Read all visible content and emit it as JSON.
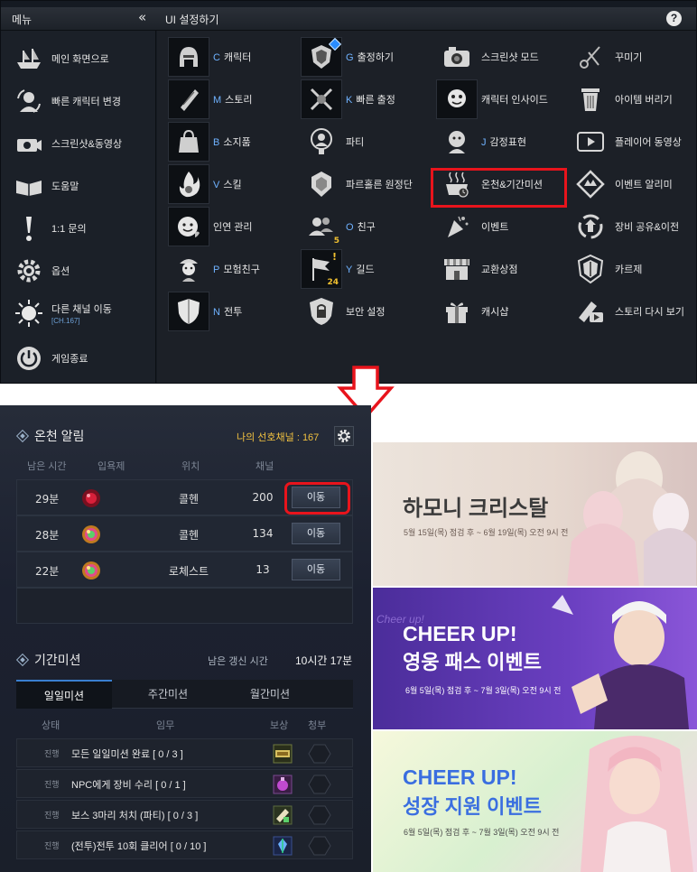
{
  "menu_window": {
    "left_title": "메뉴",
    "right_title": "UI 설정하기",
    "collapse_icon": "double-chevron-left-icon",
    "help_label": "?",
    "left_items": [
      {
        "label": "메인 화면으로",
        "icon": "ship-icon"
      },
      {
        "label": "빠른 캐릭터 변경",
        "icon": "character-swap-icon"
      },
      {
        "label": "스크린샷&동영상",
        "icon": "camera-icon"
      },
      {
        "label": "도움말",
        "icon": "book-icon"
      },
      {
        "label": "1:1 문의",
        "icon": "exclamation-icon"
      },
      {
        "label": "옵션",
        "icon": "gear-icon"
      },
      {
        "label": "다른 채널 이동",
        "sub": "[CH.167]",
        "icon": "sun-icon"
      },
      {
        "label": "게임종료",
        "icon": "power-icon"
      }
    ],
    "grid": [
      [
        {
          "hotkey": "C",
          "label": "캐릭터",
          "icon": "helmet-icon"
        },
        {
          "hotkey": "G",
          "label": "출정하기",
          "icon": "shield-crest-icon"
        },
        {
          "hotkey": "",
          "label": "스크린샷 모드",
          "icon": "camera-icon"
        },
        {
          "hotkey": "",
          "label": "꾸미기",
          "icon": "scissors-icon"
        }
      ],
      [
        {
          "hotkey": "M",
          "label": "스토리",
          "icon": "scroll-icon"
        },
        {
          "hotkey": "K",
          "label": "빠른 출정",
          "icon": "crossed-swords-icon"
        },
        {
          "hotkey": "",
          "label": "캐릭터 인사이드",
          "icon": "character-face-icon"
        },
        {
          "hotkey": "",
          "label": "아이템 버리기",
          "icon": "trash-bin-icon"
        }
      ],
      [
        {
          "hotkey": "B",
          "label": "소지품",
          "icon": "bag-icon"
        },
        {
          "hotkey": "",
          "label": "파티",
          "icon": "party-icon"
        },
        {
          "hotkey": "J",
          "label": "감정표현",
          "icon": "emote-icon"
        },
        {
          "hotkey": "",
          "label": "플레이어 동영상",
          "icon": "video-icon"
        }
      ],
      [
        {
          "hotkey": "V",
          "label": "스킬",
          "icon": "flame-icon"
        },
        {
          "hotkey": "",
          "label": "파르홀른 원정단",
          "icon": "expedition-icon"
        },
        {
          "hotkey": "",
          "label": "온천&기간미션",
          "icon": "hot-spring-icon"
        },
        {
          "hotkey": "",
          "label": "이벤트 알리미",
          "icon": "event-icon"
        }
      ],
      [
        {
          "hotkey": "",
          "label": "인연 관리",
          "icon": "smile-icon"
        },
        {
          "hotkey": "O",
          "label": "친구",
          "icon": "friends-icon",
          "badge": "5"
        },
        {
          "hotkey": "",
          "label": "이벤트",
          "icon": "party-popper-icon"
        },
        {
          "hotkey": "",
          "label": "장비 공유&이전",
          "icon": "equipment-share-icon"
        }
      ],
      [
        {
          "hotkey": "P",
          "label": "모험친구",
          "icon": "companion-icon"
        },
        {
          "hotkey": "Y",
          "label": "길드",
          "icon": "flag-icon",
          "badge": "24",
          "alert": "!"
        },
        {
          "hotkey": "",
          "label": "교환상점",
          "icon": "shop-icon"
        },
        {
          "hotkey": "",
          "label": "카르제",
          "icon": "karze-icon"
        }
      ],
      [
        {
          "hotkey": "N",
          "label": "전투",
          "icon": "shield-icon"
        },
        {
          "hotkey": "",
          "label": "보안 설정",
          "icon": "lock-icon"
        },
        {
          "hotkey": "",
          "label": "캐시샵",
          "icon": "gift-icon"
        },
        {
          "hotkey": "",
          "label": "스토리 다시 보기",
          "icon": "replay-icon"
        }
      ]
    ]
  },
  "hot_spring": {
    "title": "온천 알림",
    "preferred_channel": "나의 선호채널 : 167",
    "columns": [
      "남은 시간",
      "입욕제",
      "위치",
      "채널"
    ],
    "rows": [
      {
        "time": "29분",
        "location": "콜헨",
        "channel": "200",
        "button": "이동",
        "icon": "red-bath-salt-icon"
      },
      {
        "time": "28분",
        "location": "콜헨",
        "channel": "134",
        "button": "이동",
        "icon": "rainbow-bath-salt-icon"
      },
      {
        "time": "22분",
        "location": "로체스트",
        "channel": "13",
        "button": "이동",
        "icon": "rainbow-bath-salt-icon"
      }
    ]
  },
  "missions": {
    "title": "기간미션",
    "refresh_label": "남은 갱신 시간",
    "refresh_value": "10시간 17분",
    "tabs": [
      "일일미션",
      "주간미션",
      "월간미션"
    ],
    "columns": [
      "상태",
      "임무",
      "보상",
      "청부"
    ],
    "rows": [
      {
        "status": "진행",
        "text": "모든 일일미션 완료 [ 0 / 3 ]",
        "reward_icon": "ticket-icon"
      },
      {
        "status": "진행",
        "text": "NPC에게 장비 수리 [ 0 / 1 ]",
        "reward_icon": "potion-icon"
      },
      {
        "status": "진행",
        "text": "보스 3마리 처치 (파티) [ 0 / 3 ]",
        "reward_icon": "scroll-reward-icon"
      },
      {
        "status": "진행",
        "text": "(전투)전투 10회 클리어 [ 0 / 10 ]",
        "reward_icon": "crystal-icon"
      }
    ]
  },
  "banners": [
    {
      "title": "하모니 크리스탈",
      "sub": "5월 15일(목) 점검 후 ~ 6월 19일(목) 오전 9시 전"
    },
    {
      "title1": "CHEER UP!",
      "title2": "영웅 패스 이벤트",
      "sub": "6월 5일(목) 점검 후 ~ 7월 3일(목) 오전 9시 전",
      "watermark": "Cheer up!"
    },
    {
      "title1": "CHEER UP!",
      "title2": "성장 지원 이벤트",
      "sub": "6월 5일(목) 점검 후 ~ 7월 3일(목) 오전 9시 전"
    }
  ],
  "colors": {
    "highlight": "#e8141c",
    "accent": "#6fb2ff",
    "gold": "#f0c040"
  }
}
